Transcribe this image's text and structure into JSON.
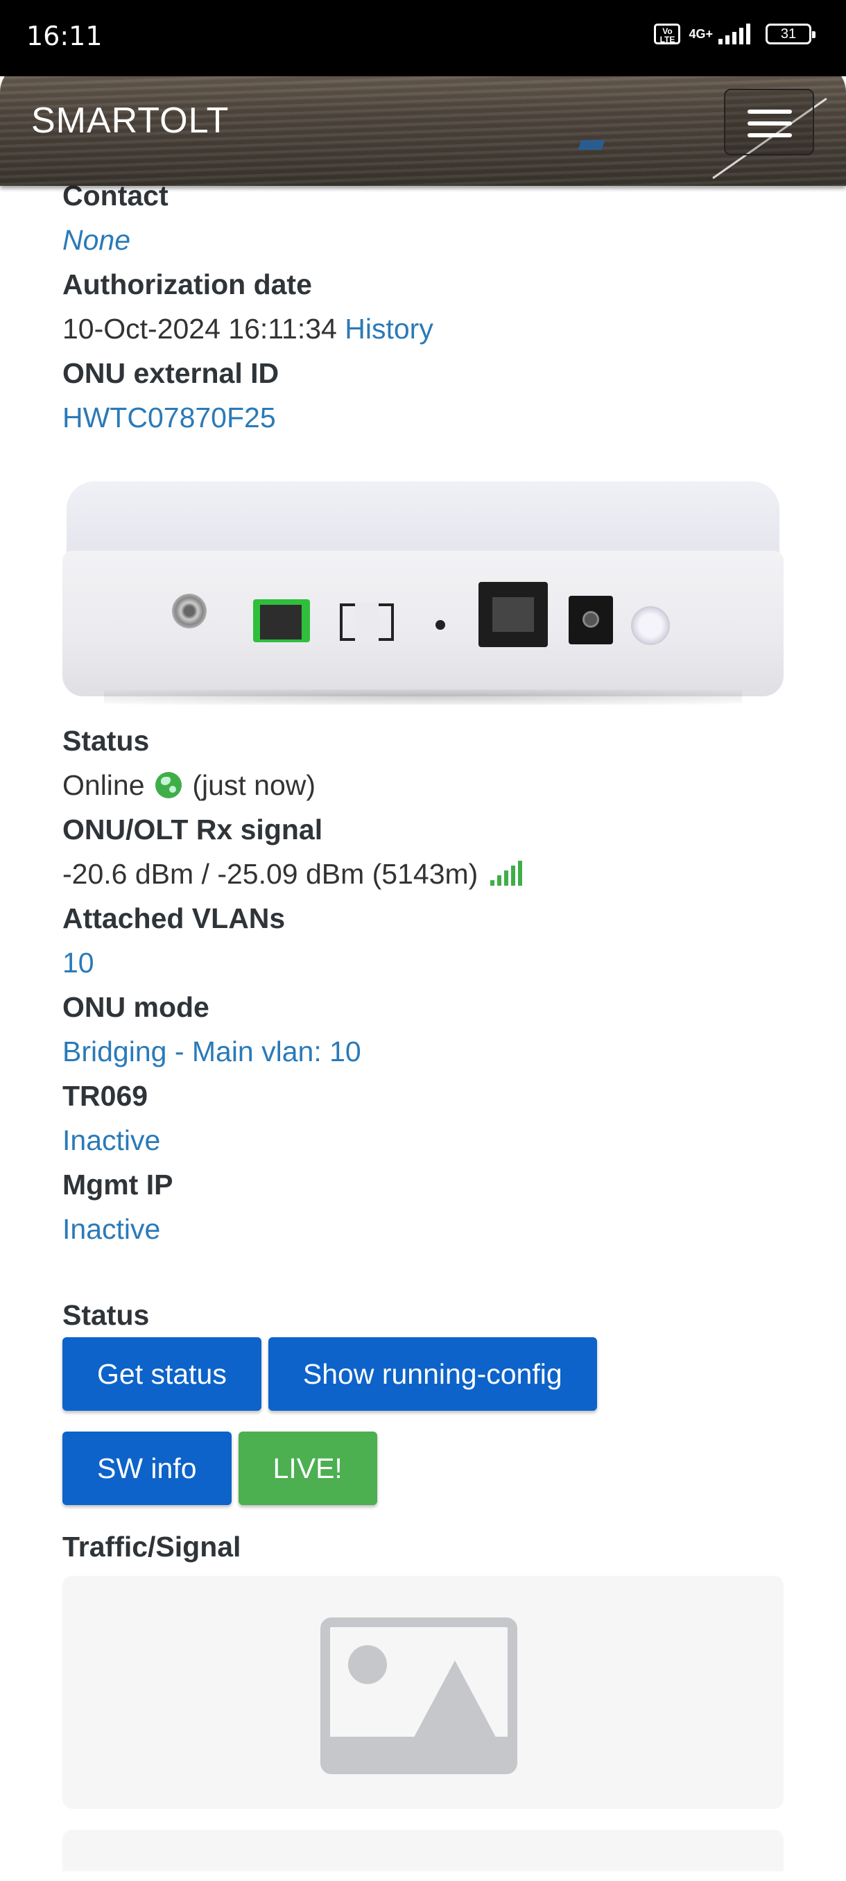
{
  "status_bar": {
    "time": "16:11",
    "volte": "Vo LTE",
    "network": "4G+",
    "battery": "31"
  },
  "navbar": {
    "brand": "SMARTOLT",
    "menu_icon": "hamburger-menu-icon"
  },
  "details": {
    "contact_label": "Contact",
    "contact_value": "None",
    "auth_date_label": "Authorization date",
    "auth_date_value": "10-Oct-2024 16:11:34",
    "auth_history_link": "History",
    "external_id_label": "ONU external ID",
    "external_id_value": "HWTC07870F25"
  },
  "device_image": {
    "icon": "onu-device-image"
  },
  "state": {
    "status_label": "Status",
    "status_value": "Online",
    "status_icon": "globe-icon",
    "status_time": "(just now)",
    "signal_label": "ONU/OLT Rx signal",
    "signal_value": "-20.6 dBm / -25.09 dBm (5143m)",
    "signal_icon": "signal-bars-icon",
    "vlans_label": "Attached VLANs",
    "vlans_value": "10",
    "mode_label": "ONU mode",
    "mode_value": "Bridging - Main vlan: 10",
    "tr069_label": "TR069",
    "tr069_value": "Inactive",
    "mgmt_label": "Mgmt IP",
    "mgmt_value": "Inactive"
  },
  "actions": {
    "section_label": "Status",
    "get_status": "Get status",
    "show_config": "Show running-config",
    "sw_info": "SW info",
    "live": "LIVE!"
  },
  "traffic": {
    "label": "Traffic/Signal",
    "placeholder_icon": "image-placeholder-icon"
  },
  "colors": {
    "link": "#2a7ab8",
    "button_primary": "#0d63c9",
    "button_live": "#4caf50",
    "online_green": "#3fae49"
  }
}
